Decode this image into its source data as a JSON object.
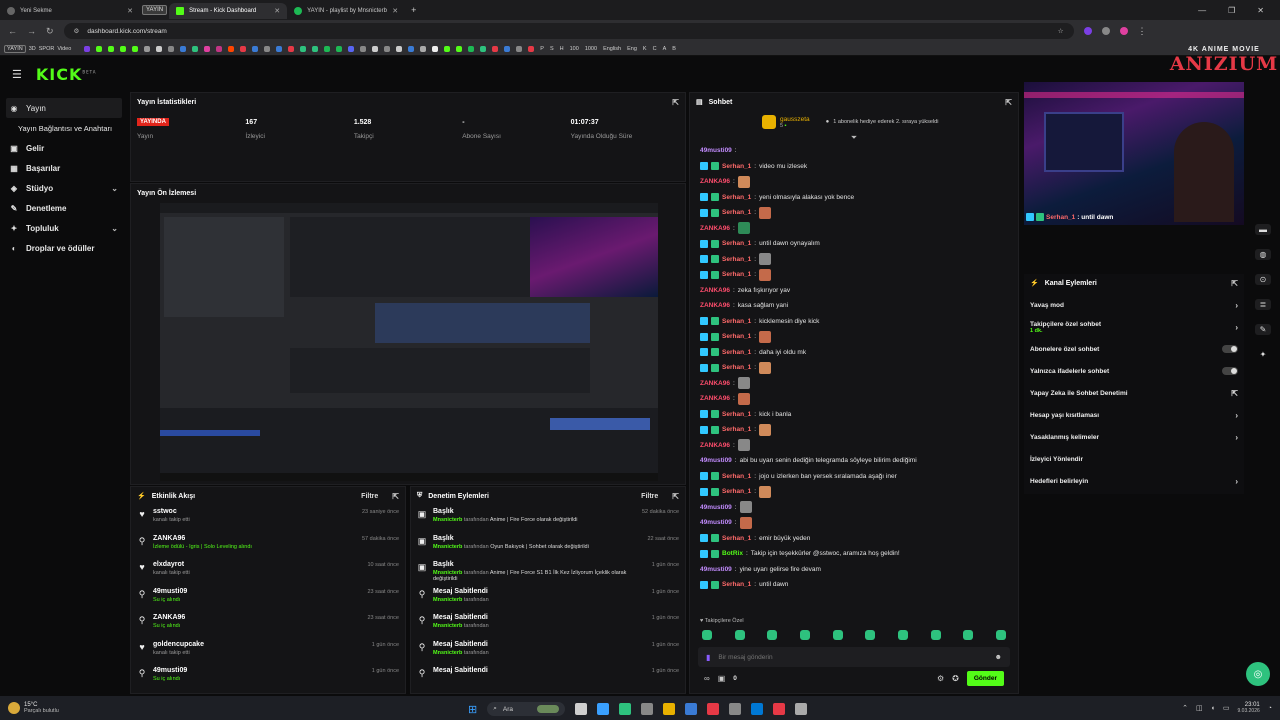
{
  "browser": {
    "tabs": [
      {
        "label": "Yeni Sekme",
        "active": false
      },
      {
        "label": "YAYIN",
        "chip": true
      },
      {
        "label": "Stream - Kick Dashboard",
        "active": true
      },
      {
        "label": "YAYIN - playlist by Mnsnicterb",
        "active": false
      }
    ],
    "new_tab": "+",
    "url": "dashboard.kick.com/stream",
    "bookmarks_left": [
      "YAYIN",
      "3D",
      "SPOR",
      "Video"
    ],
    "bookmarks_right": [
      "P",
      "S",
      "H",
      "100",
      "1000",
      "English",
      "Eng",
      "K",
      "C",
      "A",
      "B"
    ]
  },
  "kick": {
    "logo": "KICK",
    "logo_sup": "BETA"
  },
  "sidebar": {
    "items": [
      {
        "label": "Yayın",
        "icon": "broadcast-icon",
        "active": true
      },
      {
        "label": "Yayın Bağlantısı ve Anahtarı",
        "sub": true
      },
      {
        "label": "Gelir",
        "icon": "money-icon"
      },
      {
        "label": "Başarılar",
        "icon": "trophy-icon"
      },
      {
        "label": "Stüdyo",
        "icon": "studio-icon",
        "chevron": true
      },
      {
        "label": "Denetleme",
        "icon": "wrench-icon"
      },
      {
        "label": "Topluluk",
        "icon": "community-icon",
        "chevron": true
      },
      {
        "label": "Droplar ve ödüller",
        "icon": "gift-icon"
      }
    ]
  },
  "stats": {
    "title": "Yayın İstatistikleri",
    "items": [
      {
        "value": "YAYINDA",
        "label": "Yayın",
        "live": true
      },
      {
        "value": "167",
        "label": "İzleyici"
      },
      {
        "value": "1.528",
        "label": "Takipçi"
      },
      {
        "value": "-",
        "label": "Abone Sayısı"
      },
      {
        "value": "01:07:37",
        "label": "Yayında Olduğu Süre"
      }
    ]
  },
  "preview": {
    "title": "Yayın Ön İzlemesi"
  },
  "events": {
    "title": "Etkinlik Akışı",
    "filter": "Filtre",
    "items": [
      {
        "name": "sstwoc",
        "sub": "kanalı takip etti",
        "time": "23 saniye önce",
        "icon": "heart-icon",
        "green": false
      },
      {
        "name": "ZANKA96",
        "sub": "İzleme ödülü - Igris | Solo Leveling alındı",
        "time": "57 dakika önce",
        "icon": "reward-icon",
        "green": true
      },
      {
        "name": "elxdayrot",
        "sub": "kanalı takip etti",
        "time": "10 saat önce",
        "icon": "heart-icon",
        "green": false
      },
      {
        "name": "49musti09",
        "sub": "Su iç alındı",
        "time": "23 saat önce",
        "icon": "reward-icon",
        "green": true
      },
      {
        "name": "ZANKA96",
        "sub": "Su iç alındı",
        "time": "23 saat önce",
        "icon": "reward-icon",
        "green": true
      },
      {
        "name": "goldencupcake",
        "sub": "kanalı takip etti",
        "time": "1 gün önce",
        "icon": "heart-icon",
        "green": false
      },
      {
        "name": "49musti09",
        "sub": "Su iç alındı",
        "time": "1 gün önce",
        "icon": "reward-icon",
        "green": true
      }
    ]
  },
  "moderation": {
    "title": "Denetim Eylemleri",
    "filter": "Filtre",
    "items": [
      {
        "name": "Başlık",
        "actor": "Mnsnicterb",
        "mid": "tarafından",
        "detail": "Anime | Fire Force olarak değiştirildi",
        "time": "52 dakika önce",
        "icon": "title-icon"
      },
      {
        "name": "Başlık",
        "actor": "Mnsnicterb",
        "mid": "tarafından",
        "detail": "Oyun Bakıyok | Sohbet olarak değiştirildi",
        "time": "22 saat önce",
        "icon": "title-icon"
      },
      {
        "name": "Başlık",
        "actor": "Mnsnicterb",
        "mid": "tarafından",
        "detail": "Anime | Fire Force S1 B1 İlk Kez İzliyorum İçeklik olarak değiştirildi",
        "time": "1 gün önce",
        "icon": "title-icon"
      },
      {
        "name": "Mesaj Sabitlendi",
        "actor": "Mnsnicterb",
        "mid": "tarafından",
        "detail": "",
        "time": "1 gün önce",
        "icon": "pin-icon"
      },
      {
        "name": "Mesaj Sabitlendi",
        "actor": "Mnsnicterb",
        "mid": "tarafından",
        "detail": "",
        "time": "1 gün önce",
        "icon": "pin-icon"
      },
      {
        "name": "Mesaj Sabitlendi",
        "actor": "Mnsnicterb",
        "mid": "tarafından",
        "detail": "",
        "time": "1 gün önce",
        "icon": "pin-icon"
      },
      {
        "name": "Mesaj Sabitlendi",
        "actor": "",
        "mid": "",
        "detail": "",
        "time": "1 gün önce",
        "icon": "pin-icon"
      }
    ]
  },
  "chat": {
    "title": "Sohbet",
    "gift_user": "gausszeta",
    "gift_count": "5",
    "gift_text": "1 abonelik hediye ederek 2. sıraya yükseldi",
    "messages": [
      {
        "user": "49musti09",
        "color": "#c38cff",
        "text": "",
        "badges": 0,
        "emote": false
      },
      {
        "user": "Serhan_1",
        "color": "#ff6a6a",
        "text": "video mu izlesek",
        "badges": 2,
        "emote": false
      },
      {
        "user": "ZANKA96",
        "color": "#ff4d6d",
        "text": "",
        "badges": 0,
        "emote": true
      },
      {
        "user": "Serhan_1",
        "color": "#ff6a6a",
        "text": "yeni olmasıyla alakası yok bence",
        "badges": 2,
        "emote": false
      },
      {
        "user": "Serhan_1",
        "color": "#ff6a6a",
        "text": "",
        "badges": 2,
        "emote": true
      },
      {
        "user": "ZANKA96",
        "color": "#ff4d6d",
        "text": "",
        "badges": 0,
        "emote": true
      },
      {
        "user": "Serhan_1",
        "color": "#ff6a6a",
        "text": "until dawn oynayalım",
        "badges": 2,
        "emote": false
      },
      {
        "user": "Serhan_1",
        "color": "#ff6a6a",
        "text": "",
        "badges": 2,
        "emote": true
      },
      {
        "user": "Serhan_1",
        "color": "#ff6a6a",
        "text": "",
        "badges": 2,
        "emote": true
      },
      {
        "user": "ZANKA96",
        "color": "#ff4d6d",
        "text": "zeka fışkırıyor yav",
        "badges": 0,
        "emote": false
      },
      {
        "user": "ZANKA96",
        "color": "#ff4d6d",
        "text": "kasa sağlam yani",
        "badges": 0,
        "emote": false
      },
      {
        "user": "Serhan_1",
        "color": "#ff6a6a",
        "text": "kicklemesin diye kick",
        "badges": 2,
        "emote": false
      },
      {
        "user": "Serhan_1",
        "color": "#ff6a6a",
        "text": "",
        "badges": 2,
        "emote": true
      },
      {
        "user": "Serhan_1",
        "color": "#ff6a6a",
        "text": "daha iyi oldu mk",
        "badges": 2,
        "emote": false
      },
      {
        "user": "Serhan_1",
        "color": "#ff6a6a",
        "text": "",
        "badges": 2,
        "emote": true
      },
      {
        "user": "ZANKA96",
        "color": "#ff4d6d",
        "text": "",
        "badges": 0,
        "emote": true
      },
      {
        "user": "ZANKA96",
        "color": "#ff4d6d",
        "text": "",
        "badges": 0,
        "emote": true
      },
      {
        "user": "Serhan_1",
        "color": "#ff6a6a",
        "text": "kick i banla",
        "badges": 2,
        "emote": false
      },
      {
        "user": "Serhan_1",
        "color": "#ff6a6a",
        "text": "",
        "badges": 2,
        "emote": true
      },
      {
        "user": "ZANKA96",
        "color": "#ff4d6d",
        "text": "",
        "badges": 0,
        "emote": true
      },
      {
        "user": "49musti09",
        "color": "#c38cff",
        "text": "abi bu uyarı senin dediğin telegramda söyleye bilirim dediğimi",
        "badges": 0,
        "emote": false
      },
      {
        "user": "Serhan_1",
        "color": "#ff6a6a",
        "text": "jojo u izlerken ban yersek sıralamada aşağı iner",
        "badges": 2,
        "emote": false
      },
      {
        "user": "Serhan_1",
        "color": "#ff6a6a",
        "text": "",
        "badges": 2,
        "emote": true
      },
      {
        "user": "49musti09",
        "color": "#c38cff",
        "text": "",
        "badges": 0,
        "emote": true
      },
      {
        "user": "49musti09",
        "color": "#c38cff",
        "text": "",
        "badges": 0,
        "emote": true
      },
      {
        "user": "Serhan_1",
        "color": "#ff6a6a",
        "text": "emir büyük yeden",
        "badges": 2,
        "emote": false
      },
      {
        "user": "BotRix",
        "color": "#53fc18",
        "text": "Takip için teşekkürler @sstwoc, aramıza hoş geldin!",
        "badges": 2,
        "emote": false
      },
      {
        "user": "49musti09",
        "color": "#c38cff",
        "text": "yine uyarı gelirse fire devam",
        "badges": 0,
        "emote": false
      },
      {
        "user": "Serhan_1",
        "color": "#ff6a6a",
        "text": "until dawn",
        "badges": 2,
        "emote": false
      }
    ],
    "followers_only": "Takipçilere Özel",
    "input_placeholder": "Bir mesaj gönderin",
    "send": "Gönder",
    "loop_count": "0"
  },
  "right": {
    "brand_small": "4K ANIME MOVIE",
    "brand_big": "ANIZIUM",
    "overlay_user": "Serhan_1",
    "overlay_msg": ": until dawn",
    "channel_actions_title": "Kanal Eylemleri",
    "actions": [
      {
        "label": "Yavaş mod",
        "type": "chevron"
      },
      {
        "label": "Takipçilere özel sohbet",
        "sub": "1 dk.",
        "type": "chevron"
      },
      {
        "label": "Abonelere özel sohbet",
        "type": "toggle"
      },
      {
        "label": "Yalnızca ifadelerle sohbet",
        "type": "toggle"
      },
      {
        "label": "Yapay Zeka ile Sohbet Denetimi",
        "type": "external"
      },
      {
        "label": "Hesap yaşı kısıtlaması",
        "type": "chevron"
      },
      {
        "label": "Yasaklanmış kelimeler",
        "type": "chevron"
      },
      {
        "label": "İzleyici Yönlendir",
        "type": "none"
      },
      {
        "label": "Hedefleri belirleyin",
        "type": "chevron"
      }
    ]
  },
  "taskbar": {
    "weather_temp": "15°C",
    "weather_desc": "Parçalı bulutlu",
    "search": "Ara",
    "time": "23:01",
    "date": "9.03.2026"
  },
  "colors": {
    "kick_green": "#53fc18",
    "live_red": "#e1251b"
  }
}
